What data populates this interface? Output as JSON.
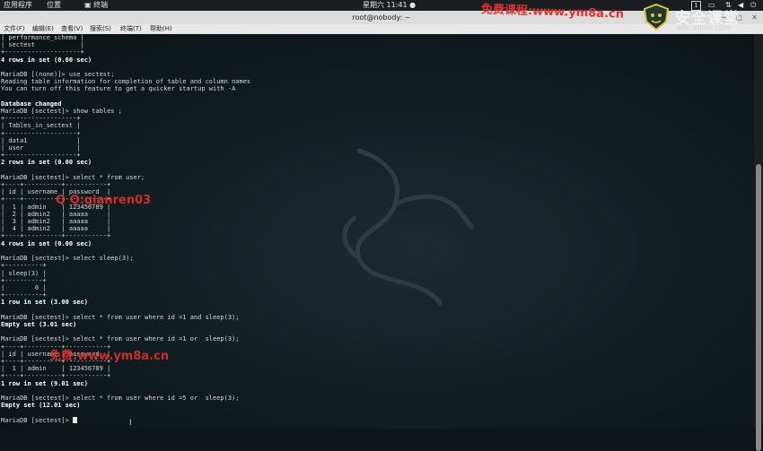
{
  "topbar": {
    "applications": "应用程序",
    "places": "位置",
    "terminal_menu": "终端",
    "clock": "星期六 11:41",
    "workspace": "1"
  },
  "window": {
    "title": "root@nobody: ~"
  },
  "menubar": {
    "items": [
      "文件(F)",
      "编辑(E)",
      "查看(V)",
      "搜索(S)",
      "终端(T)",
      "帮助(H)"
    ]
  },
  "terminal": {
    "lines": [
      "| performance_schema |",
      "| sectest            |",
      "+--------------------+",
      "4 rows in set (0.00 sec)",
      "",
      "MariaDB [(none)]> use sectest;",
      "Reading table information for completion of table and column names",
      "You can turn off this feature to get a quicker startup with -A",
      "",
      "Database changed",
      "MariaDB [sectest]> show tables ;",
      "+-------------------+",
      "| Tables_in_sectest |",
      "+-------------------+",
      "| data1             |",
      "| user              |",
      "+-------------------+",
      "2 rows in set (0.00 sec)",
      "",
      "MariaDB [sectest]> select * from user;",
      "+----+----------+-----------+",
      "| id | username | password  |",
      "+----+----------+-----------+",
      "|  1 | admin    | 123456789 |",
      "|  2 | admin2   | aaaaa     |",
      "|  3 | admin2   | aaaaa     |",
      "|  4 | admin2   | aaaaa     |",
      "+----+----------+-----------+",
      "4 rows in set (0.00 sec)",
      "",
      "MariaDB [sectest]> select sleep(3);",
      "+----------+",
      "| sleep(3) |",
      "+----------+",
      "|        0 |",
      "+----------+",
      "1 row in set (3.00 sec)",
      "",
      "MariaDB [sectest]> select * from user where id =1 and sleep(3);",
      "Empty set (3.01 sec)",
      "",
      "MariaDB [sectest]> select * from user where id =1 or  sleep(3);",
      "+----+----------+-----------+",
      "| id | username | password  |",
      "+----+----------+-----------+",
      "|  1 | admin    | 123456789 |",
      "+----+----------+-----------+",
      "1 row in set (9.01 sec)",
      "",
      "MariaDB [sectest]> select * from user where id =5 or  sleep(3);",
      "Empty set (12.01 sec)",
      "",
      "MariaDB [sectest]> "
    ],
    "bold_line_indexes": [
      3,
      9,
      17,
      28,
      36,
      39,
      47,
      50
    ]
  },
  "watermarks": {
    "top": "免费课程:www.ym8a.cn",
    "middle": "Q Q:qianren03",
    "bottom": "免费:www.ym8a.cn",
    "logo_text": "安全课堂",
    "logo_sub": "edu.aqniu.com",
    "color": "#e0322f"
  },
  "icons": [
    "terminal-icon",
    "network-icon",
    "volume-icon",
    "power-icon",
    "minimize-icon",
    "maximize-icon",
    "close-icon"
  ]
}
